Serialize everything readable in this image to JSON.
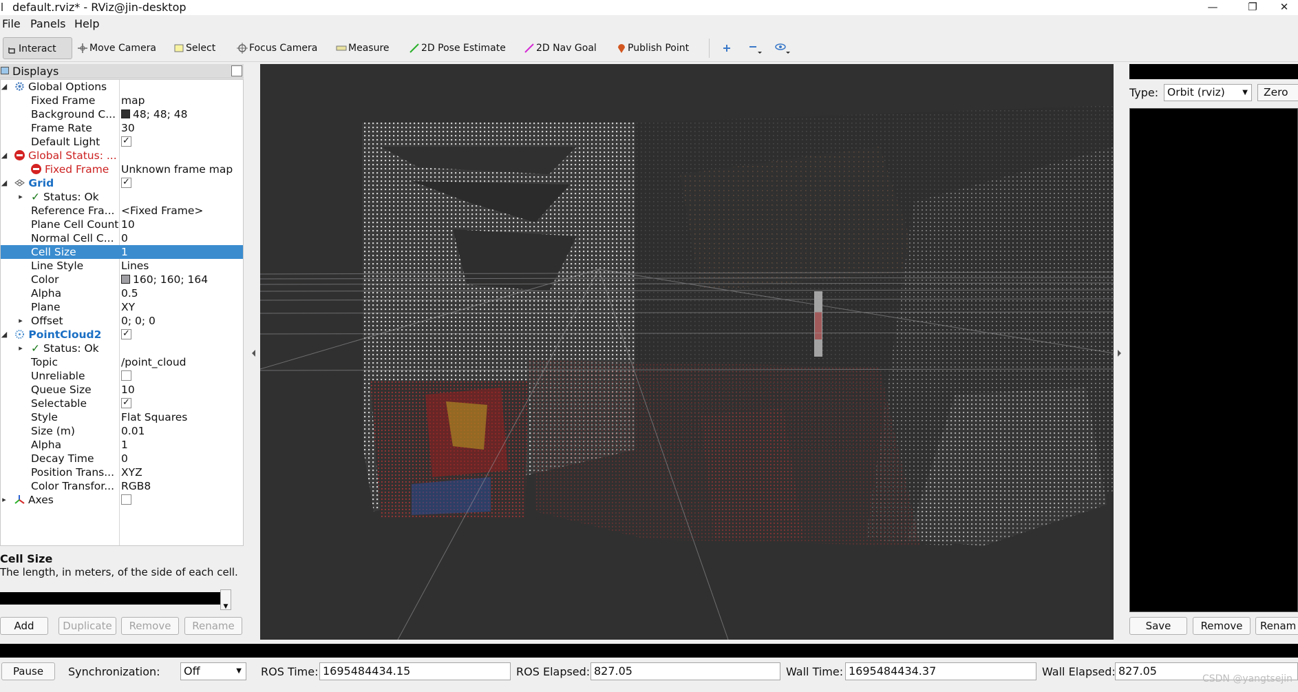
{
  "window": {
    "title": "default.rviz* - RViz@jin-desktop",
    "minimize": "—",
    "maximize": "❐",
    "close": "✕"
  },
  "menu": [
    "File",
    "Panels",
    "Help"
  ],
  "toolbar": {
    "interact": "Interact",
    "move_camera": "Move Camera",
    "select": "Select",
    "focus_camera": "Focus Camera",
    "measure": "Measure",
    "pose_estimate": "2D Pose Estimate",
    "nav_goal": "2D Nav Goal",
    "publish_point": "Publish Point"
  },
  "displays": {
    "title": "Displays",
    "rows": [
      {
        "key": "Global Options",
        "value": ""
      },
      {
        "key": "Fixed Frame",
        "value": "map"
      },
      {
        "key": "Background C...",
        "value": "48; 48; 48"
      },
      {
        "key": "Frame Rate",
        "value": "30"
      },
      {
        "key": "Default Light",
        "value": ""
      },
      {
        "key": "Global Status: ...",
        "value": ""
      },
      {
        "key": "Fixed Frame",
        "value": "Unknown frame map"
      },
      {
        "key": "Grid",
        "value": ""
      },
      {
        "key": "Status: Ok",
        "value": ""
      },
      {
        "key": "Reference Fra...",
        "value": "<Fixed Frame>"
      },
      {
        "key": "Plane Cell Count",
        "value": "10"
      },
      {
        "key": "Normal Cell C...",
        "value": "0"
      },
      {
        "key": "Cell Size",
        "value": "1"
      },
      {
        "key": "Line Style",
        "value": "Lines"
      },
      {
        "key": "Color",
        "value": "160; 160; 164"
      },
      {
        "key": "Alpha",
        "value": "0.5"
      },
      {
        "key": "Plane",
        "value": "XY"
      },
      {
        "key": "Offset",
        "value": "0; 0; 0"
      },
      {
        "key": "PointCloud2",
        "value": ""
      },
      {
        "key": "Status: Ok",
        "value": ""
      },
      {
        "key": "Topic",
        "value": "/point_cloud"
      },
      {
        "key": "Unreliable",
        "value": ""
      },
      {
        "key": "Queue Size",
        "value": "10"
      },
      {
        "key": "Selectable",
        "value": ""
      },
      {
        "key": "Style",
        "value": "Flat Squares"
      },
      {
        "key": "Size (m)",
        "value": "0.01"
      },
      {
        "key": "Alpha",
        "value": "1"
      },
      {
        "key": "Decay Time",
        "value": "0"
      },
      {
        "key": "Position Trans...",
        "value": "XYZ"
      },
      {
        "key": "Color Transfor...",
        "value": "RGB8"
      },
      {
        "key": "Axes",
        "value": ""
      }
    ],
    "help_title": "Cell Size",
    "help_text": "The length, in meters, of the side of each cell.",
    "buttons": {
      "add": "Add",
      "duplicate": "Duplicate",
      "remove": "Remove",
      "rename": "Rename"
    }
  },
  "views": {
    "type_label": "Type:",
    "type_value": "Orbit (rviz)",
    "zero": "Zero",
    "save": "Save",
    "remove": "Remove",
    "rename": "Renam"
  },
  "time": {
    "pause": "Pause",
    "sync_label": "Synchronization:",
    "sync_value": "Off",
    "ros_time_label": "ROS Time:",
    "ros_time": "1695484434.15",
    "ros_elapsed_label": "ROS Elapsed:",
    "ros_elapsed": "827.05",
    "wall_time_label": "Wall Time:",
    "wall_time": "1695484434.37",
    "wall_elapsed_label": "Wall Elapsed:",
    "wall_elapsed": "827.05"
  },
  "colors": {
    "background": "#303030",
    "grid": "#a0a0a4",
    "selection": "#3a8ccf",
    "error": "#cc1f1f"
  },
  "watermark": "CSDN @yangtsejin"
}
